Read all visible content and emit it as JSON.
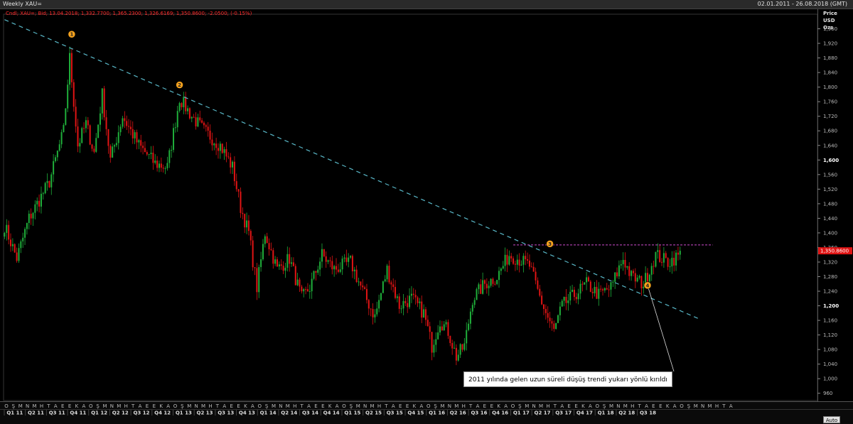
{
  "window": {
    "title": "Weekly XAU=",
    "date_range": "02.01.2011 - 26.08.2018 (GMT)"
  },
  "quote_line": "Cndl; XAU=; Bid; 13.04.2018; 1,332.7700; 1,365.2300; 1,326.6169; 1,350.8600; -2.0500; (-0.15%)",
  "axis_header": [
    "Price",
    "USD",
    "Ozs"
  ],
  "current_price_label": "1,350.8600",
  "auto_button": "Auto",
  "annotation": "2011 yılında gelen uzun süreli düşüş trendi yukarı yönlü kırıldı",
  "markers": [
    "1",
    "2",
    "3",
    "4"
  ],
  "colors": {
    "up": "#1fae3a",
    "down": "#e01414",
    "trendline": "#59b8c8",
    "resistance": "#d14cd1",
    "marker": "#f5a21e",
    "price_tag": "#e01414"
  },
  "chart_data": {
    "type": "candlestick",
    "ylim": [
      940,
      2000
    ],
    "y_ticks": [
      "960",
      "1,000",
      "1,040",
      "1,080",
      "1,120",
      "1,160",
      "1,200",
      "1,240",
      "1,280",
      "1,320",
      "1,360",
      "1,400",
      "1,440",
      "1,480",
      "1,520",
      "1,560",
      "1,600",
      "1,640",
      "1,680",
      "1,720",
      "1,760",
      "1,800",
      "1,840",
      "1,880",
      "1,920",
      "1,960"
    ],
    "bold_ticks": [
      "1,200",
      "1,600"
    ],
    "month_labels": [
      "O",
      "Ş",
      "M",
      "N",
      "M",
      "H",
      "T",
      "A",
      "E",
      "E",
      "K",
      "A",
      "O",
      "Ş",
      "M",
      "N",
      "M",
      "H",
      "T",
      "A",
      "E",
      "E",
      "K",
      "A",
      "O",
      "Ş",
      "M",
      "N",
      "M",
      "H",
      "T",
      "A",
      "E",
      "E",
      "K",
      "A",
      "O",
      "Ş",
      "M",
      "N",
      "M",
      "H",
      "T",
      "A",
      "E",
      "E",
      "K",
      "A",
      "O",
      "Ş",
      "M",
      "N",
      "M",
      "H",
      "T",
      "A",
      "E",
      "E",
      "K",
      "A",
      "O",
      "Ş",
      "M",
      "N",
      "M",
      "H",
      "T",
      "A",
      "E",
      "E",
      "K",
      "A",
      "O",
      "Ş",
      "M",
      "N",
      "M",
      "H",
      "T",
      "A",
      "E",
      "E",
      "K",
      "A",
      "O",
      "Ş",
      "M",
      "N",
      "M",
      "H",
      "T",
      "A",
      "E",
      "E",
      "K",
      "A",
      "O",
      "Ş",
      "M",
      "N",
      "M",
      "H",
      "T",
      "A"
    ],
    "quarter_labels": [
      "Q1 11",
      "Q2 11",
      "Q3 11",
      "Q4 11",
      "Q1 12",
      "Q2 12",
      "Q3 12",
      "Q4 12",
      "Q1 13",
      "Q2 13",
      "Q3 13",
      "Q4 13",
      "Q1 14",
      "Q2 14",
      "Q3 14",
      "Q4 14",
      "Q1 15",
      "Q2 15",
      "Q3 15",
      "Q4 15",
      "Q1 16",
      "Q2 16",
      "Q3 16",
      "Q4 16",
      "Q1 17",
      "Q2 17",
      "Q3 17",
      "Q4 17",
      "Q1 18",
      "Q2 18",
      "Q3 18"
    ],
    "anchors": [
      {
        "t": 0,
        "p": 1420
      },
      {
        "t": 6,
        "p": 1330
      },
      {
        "t": 12,
        "p": 1440
      },
      {
        "t": 22,
        "p": 1540
      },
      {
        "t": 29,
        "p": 1680
      },
      {
        "t": 32,
        "p": 1880
      },
      {
        "t": 36,
        "p": 1640
      },
      {
        "t": 40,
        "p": 1700
      },
      {
        "t": 44,
        "p": 1620
      },
      {
        "t": 48,
        "p": 1780
      },
      {
        "t": 52,
        "p": 1600
      },
      {
        "t": 58,
        "p": 1720
      },
      {
        "t": 66,
        "p": 1640
      },
      {
        "t": 74,
        "p": 1590
      },
      {
        "t": 80,
        "p": 1580
      },
      {
        "t": 86,
        "p": 1770
      },
      {
        "t": 92,
        "p": 1720
      },
      {
        "t": 98,
        "p": 1680
      },
      {
        "t": 106,
        "p": 1640
      },
      {
        "t": 112,
        "p": 1580
      },
      {
        "t": 116,
        "p": 1470
      },
      {
        "t": 120,
        "p": 1400
      },
      {
        "t": 124,
        "p": 1250
      },
      {
        "t": 128,
        "p": 1400
      },
      {
        "t": 134,
        "p": 1300
      },
      {
        "t": 140,
        "p": 1330
      },
      {
        "t": 146,
        "p": 1220
      },
      {
        "t": 150,
        "p": 1250
      },
      {
        "t": 156,
        "p": 1340
      },
      {
        "t": 162,
        "p": 1300
      },
      {
        "t": 170,
        "p": 1320
      },
      {
        "t": 176,
        "p": 1240
      },
      {
        "t": 182,
        "p": 1170
      },
      {
        "t": 188,
        "p": 1300
      },
      {
        "t": 194,
        "p": 1200
      },
      {
        "t": 200,
        "p": 1220
      },
      {
        "t": 206,
        "p": 1180
      },
      {
        "t": 210,
        "p": 1090
      },
      {
        "t": 214,
        "p": 1160
      },
      {
        "t": 218,
        "p": 1130
      },
      {
        "t": 222,
        "p": 1060
      },
      {
        "t": 226,
        "p": 1090
      },
      {
        "t": 230,
        "p": 1220
      },
      {
        "t": 236,
        "p": 1260
      },
      {
        "t": 242,
        "p": 1280
      },
      {
        "t": 248,
        "p": 1340
      },
      {
        "t": 252,
        "p": 1330
      },
      {
        "t": 258,
        "p": 1310
      },
      {
        "t": 262,
        "p": 1240
      },
      {
        "t": 266,
        "p": 1180
      },
      {
        "t": 270,
        "p": 1130
      },
      {
        "t": 274,
        "p": 1200
      },
      {
        "t": 280,
        "p": 1230
      },
      {
        "t": 286,
        "p": 1260
      },
      {
        "t": 292,
        "p": 1230
      },
      {
        "t": 298,
        "p": 1250
      },
      {
        "t": 304,
        "p": 1330
      },
      {
        "t": 308,
        "p": 1280
      },
      {
        "t": 314,
        "p": 1260
      },
      {
        "t": 320,
        "p": 1340
      },
      {
        "t": 326,
        "p": 1320
      },
      {
        "t": 332,
        "p": 1340
      }
    ],
    "trendline": {
      "start": {
        "t": 0,
        "p": 1985
      },
      "end": {
        "t": 341,
        "p": 1165
      }
    },
    "resistance": {
      "from_t": 250,
      "to_t": 348,
      "p": 1367
    },
    "marker_points": [
      {
        "id": "1",
        "t": 33,
        "p": 1945
      },
      {
        "id": "2",
        "t": 86,
        "p": 1806
      },
      {
        "id": "3",
        "t": 268,
        "p": 1370
      },
      {
        "id": "4",
        "t": 316,
        "p": 1256
      }
    ],
    "last_price": 1350.86
  }
}
